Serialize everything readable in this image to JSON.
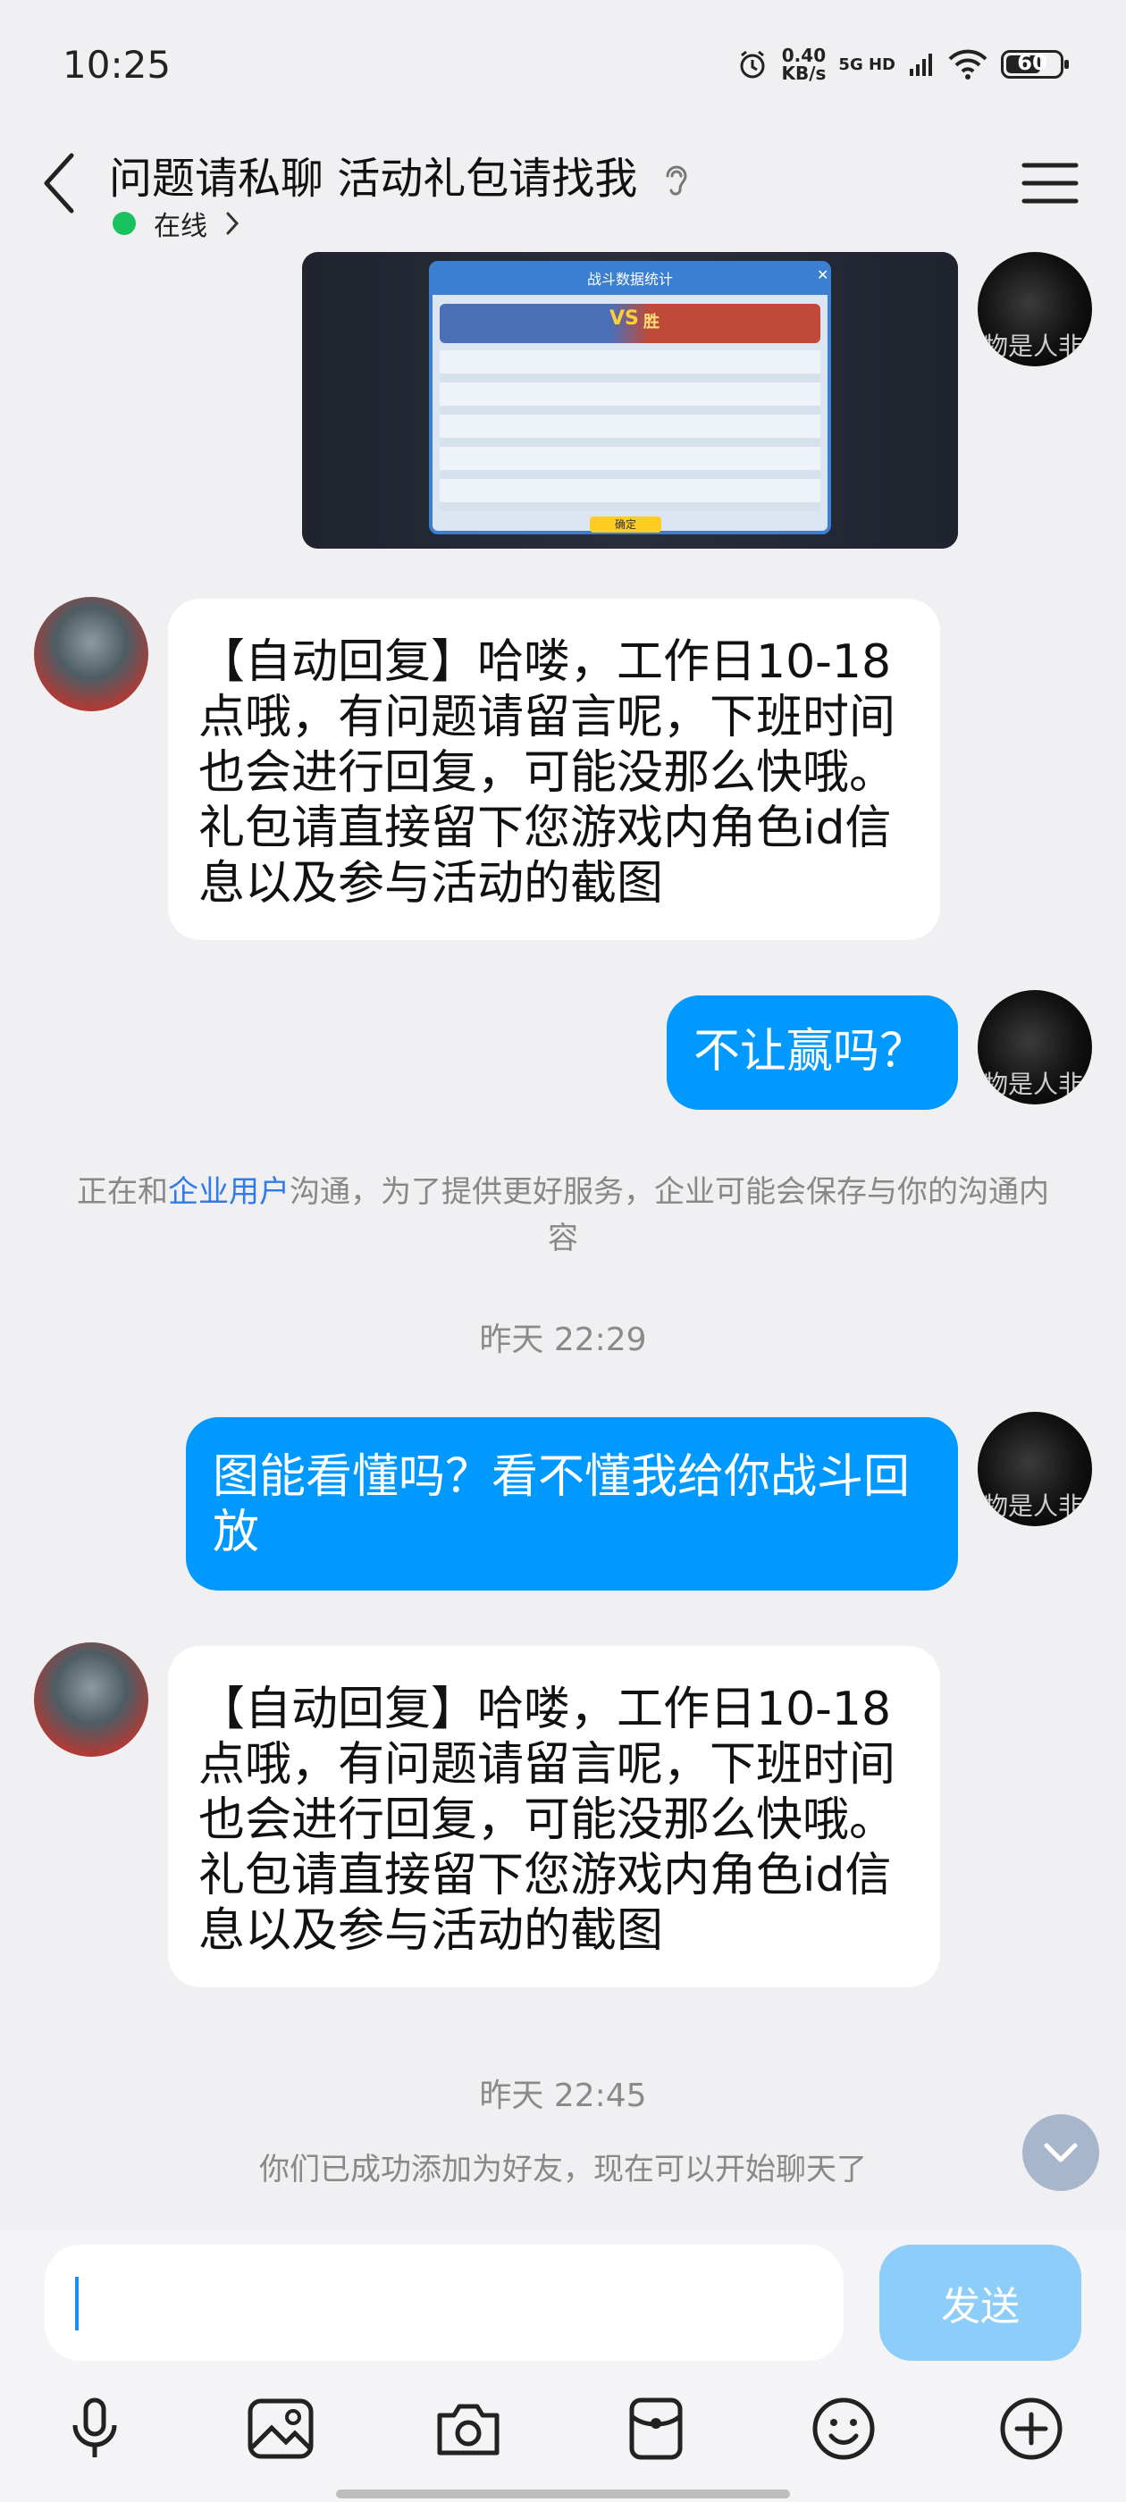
{
  "status_bar": {
    "time": "10:25",
    "speed_value": "0.40",
    "speed_unit": "KB/s",
    "network": "5G HD",
    "battery": "60"
  },
  "header": {
    "title": "问题请私聊 活动礼包请找我",
    "status": "在线"
  },
  "screenshot": {
    "title": "战斗数据统计",
    "result": "胜",
    "vs": "VS",
    "button": "确定"
  },
  "messages": [
    {
      "text": "【自动回复】哈喽，工作日10-18点哦，有问题请留言呢，下班时间也会进行回复，可能没那么快哦。礼包请直接留下您游戏内角色id信息以及参与活动的截图"
    },
    {
      "text": "不让赢吗？"
    },
    {
      "text": "图能看懂吗？看不懂我给你战斗回放"
    },
    {
      "text": "【自动回复】哈喽，工作日10-18点哦，有问题请留言呢，下班时间也会进行回复，可能没那么快哦。礼包请直接留下您游戏内角色id信息以及参与活动的截图"
    }
  ],
  "notice": {
    "prefix": "正在和",
    "link": "企业用户",
    "suffix": "沟通，为了提供更好服务，企业可能会保存与你的沟通内容"
  },
  "timestamps": [
    "昨天 22:29",
    "昨天 22:45"
  ],
  "friend_added": "你们已成功添加为好友，现在可以开始聊天了",
  "avatar_text": "物是人非",
  "input": {
    "send_label": "发送"
  },
  "colors": {
    "accent": "#0099ff",
    "online": "#19c15f",
    "link": "#2f7bea"
  }
}
